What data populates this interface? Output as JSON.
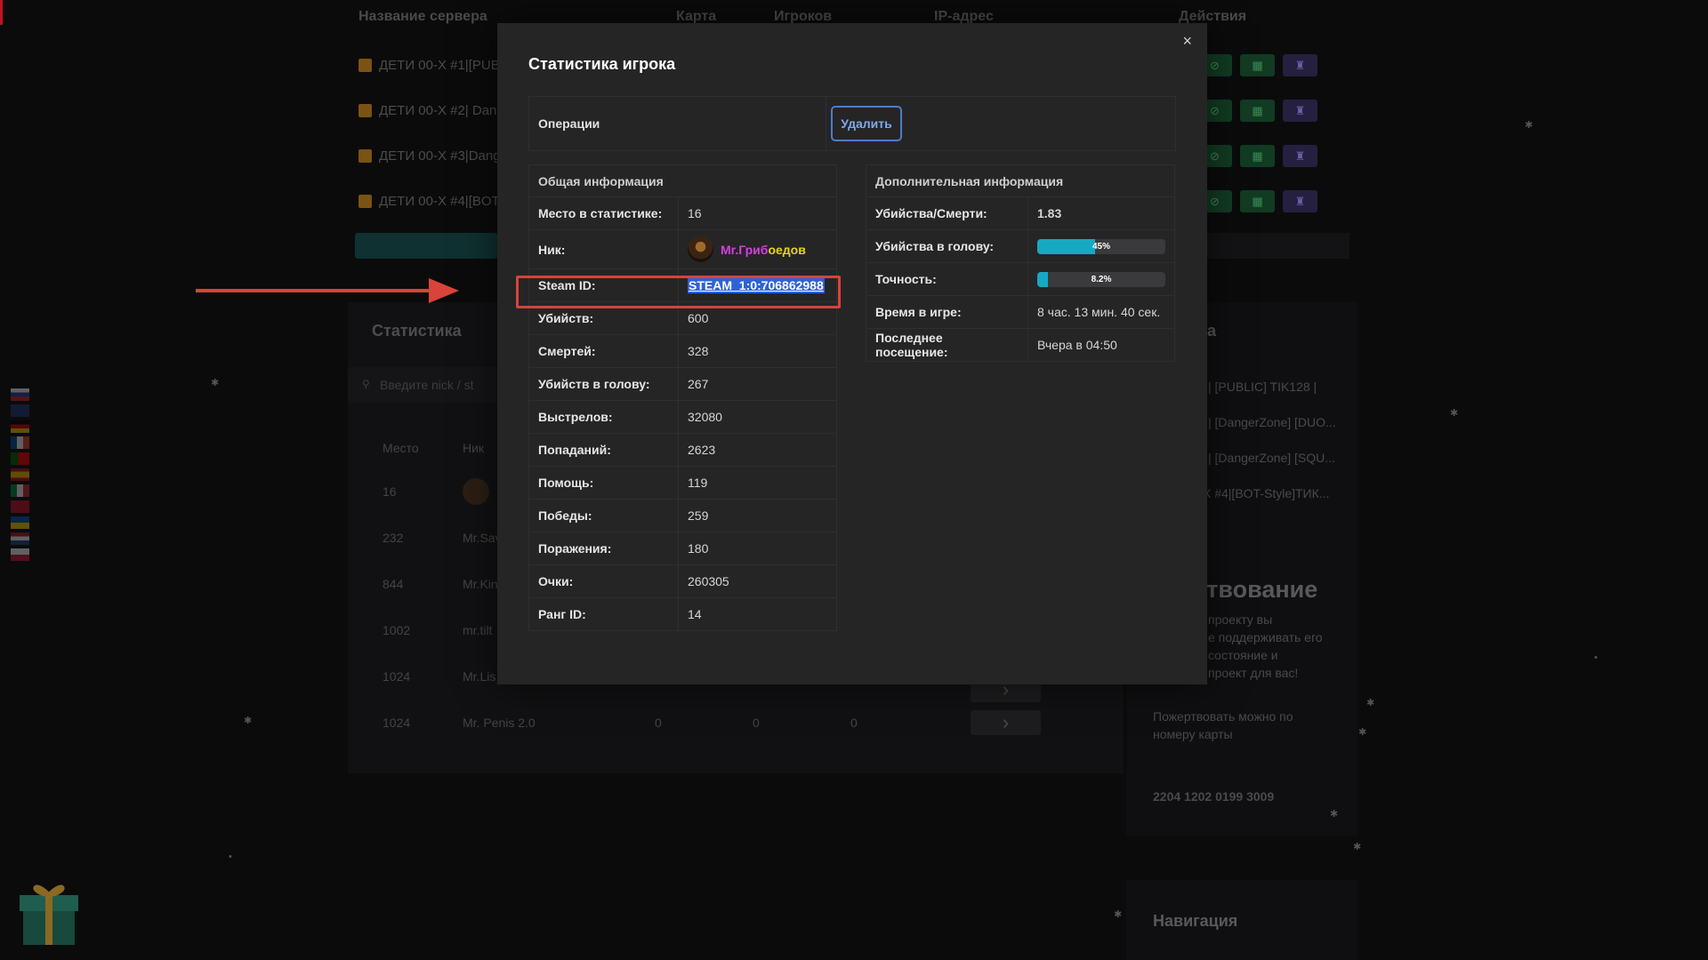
{
  "background": {
    "columns": [
      "Название сервера",
      "Карта",
      "Игроков",
      "IP-адрес",
      "Действия"
    ],
    "servers": [
      "ДЕТИ 00-Х #1|[PUB",
      "ДЕТИ 00-Х #2| Dan",
      "ДЕТИ 00-Х #3|Dang",
      "ДЕТИ 00-Х #4|[BOT"
    ],
    "stats_title": "Статистика",
    "search_placeholder": "Введите nick / st",
    "table_headers": [
      "Место",
      "Ник"
    ],
    "rows": [
      {
        "place": "16",
        "nick": "",
        "c1": "",
        "c2": "",
        "c3": ""
      },
      {
        "place": "232",
        "nick": "Mr.Sav",
        "c1": "",
        "c2": "",
        "c3": ""
      },
      {
        "place": "844",
        "nick": "Mr.Kin",
        "c1": "",
        "c2": "",
        "c3": ""
      },
      {
        "place": "1002",
        "nick": "mr.tilt",
        "c1": "",
        "c2": "",
        "c3": ""
      },
      {
        "place": "1024",
        "nick": "Mr.Lis",
        "c1": "",
        "c2": "",
        "c3": ""
      },
      {
        "place": "1024",
        "nick": "Mr. Penis 2.0",
        "c1": "0",
        "c2": "0",
        "c3": "0"
      }
    ],
    "right_panel": {
      "title_partial": "а",
      "servers": [
        "| [PUBLIC] TIK128 |",
        "| [DangerZone] [DUO...",
        "| [DangerZone] [SQU...",
        "X #4|[BOT-Style]ТИК..."
      ],
      "donate_title": "ертвование",
      "donate_text": [
        "проекту вы",
        "е поддерживать его",
        "состояние и",
        "проект для вас!"
      ],
      "donate_card_text": [
        "Пожертвовать можно по",
        "номеру карты"
      ],
      "card_number": "2204 1202 0199 3009",
      "nav_title": "Навигация"
    }
  },
  "modal": {
    "title": "Статистика игрока",
    "close": "×",
    "operations_label": "Операции",
    "delete_button": "Удалить",
    "general": {
      "header": "Общая информация",
      "rank_label": "Место в статистике:",
      "rank_value": "16",
      "nick_label": "Ник:",
      "nick_part1": "Mr.Гриб",
      "nick_part2": "оедов",
      "steam_label": "Steam ID:",
      "steam_value": "STEAM_1:0:706862988",
      "rows": [
        {
          "label": "Убийств:",
          "value": "600"
        },
        {
          "label": "Смертей:",
          "value": "328"
        },
        {
          "label": "Убийств в голову:",
          "value": "267"
        },
        {
          "label": "Выстрелов:",
          "value": "32080"
        },
        {
          "label": "Попаданий:",
          "value": "2623"
        },
        {
          "label": "Помощь:",
          "value": "119"
        },
        {
          "label": "Победы:",
          "value": "259"
        },
        {
          "label": "Поражения:",
          "value": "180"
        },
        {
          "label": "Очки:",
          "value": "260305"
        },
        {
          "label": "Ранг ID:",
          "value": "14"
        }
      ]
    },
    "additional": {
      "header": "Дополнительная информация",
      "kd_label": "Убийства/Смерти:",
      "kd_value": "1.83",
      "hs_label": "Убийства в голову:",
      "hs_text": "45%",
      "hs_fraction": 0.45,
      "acc_label": "Точность:",
      "acc_text": "8.2%",
      "acc_fraction": 0.082,
      "time_label": "Время в игре:",
      "time_value": "8 час. 13 мин. 40 сек.",
      "last_label": "Последнее посещение:",
      "last_value": "Вчера в 04:50"
    },
    "colors": {
      "nick_part1": "#d63fe0",
      "nick_part2": "#e7d41c",
      "progress": "#17a8c2",
      "highlight": "#d9433a",
      "delete_border": "#4d7cc9"
    }
  }
}
